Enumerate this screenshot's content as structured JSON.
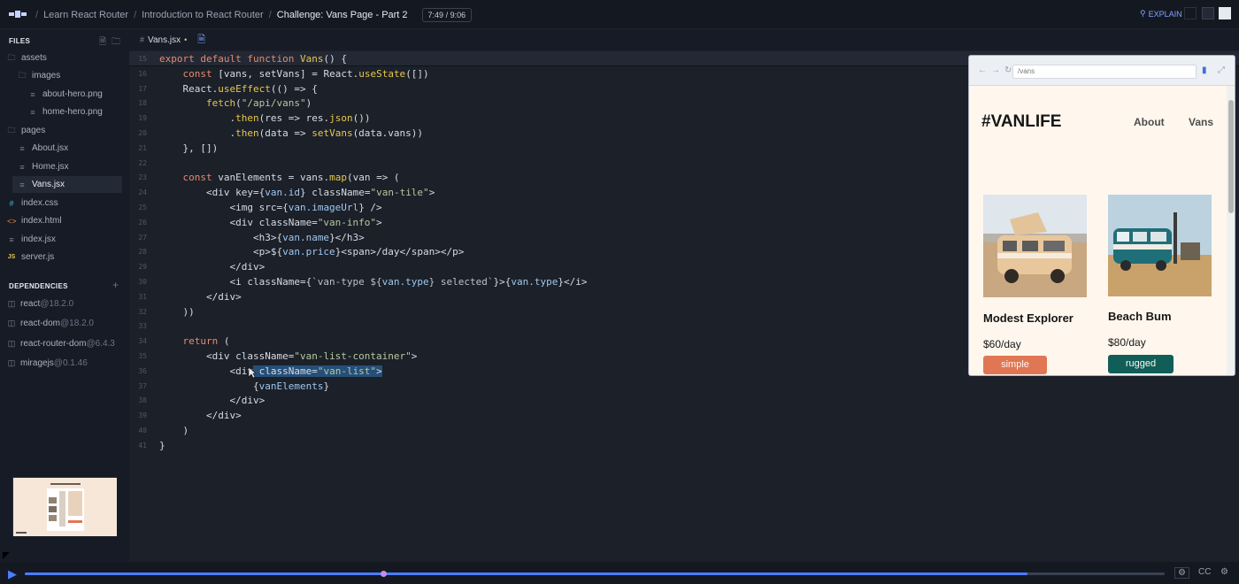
{
  "breadcrumb": {
    "items": [
      "Learn React Router",
      "Introduction to React Router",
      "Challenge: Vans Page - Part 2"
    ],
    "separator": "/",
    "time": "7:49 / 9:06"
  },
  "header": {
    "explain_label": "EXPLAIN"
  },
  "sidebar": {
    "files_heading": "FILES",
    "tree": [
      {
        "name": "assets",
        "type": "folder"
      },
      {
        "name": "images",
        "type": "folder"
      },
      {
        "name": "about-hero.png",
        "type": "file"
      },
      {
        "name": "home-hero.png",
        "type": "file"
      },
      {
        "name": "pages",
        "type": "folder"
      },
      {
        "name": "About.jsx",
        "type": "file"
      },
      {
        "name": "Home.jsx",
        "type": "file"
      },
      {
        "name": "Vans.jsx",
        "type": "file"
      },
      {
        "name": "index.css",
        "type": "css"
      },
      {
        "name": "index.html",
        "type": "html"
      },
      {
        "name": "index.jsx",
        "type": "file"
      },
      {
        "name": "server.js",
        "type": "js"
      }
    ],
    "dependencies_heading": "DEPENDENCIES",
    "dependencies": [
      {
        "name": "react",
        "version": "@18.2.0"
      },
      {
        "name": "react-dom",
        "version": "@18.2.0"
      },
      {
        "name": "react-router-dom",
        "version": "@6.4.3"
      },
      {
        "name": "miragejs",
        "version": "@0.1.46"
      }
    ]
  },
  "editor": {
    "tab_label": "Vans.jsx",
    "lines": [
      {
        "n": "15",
        "text": "export default function Vans() {"
      },
      {
        "n": "16",
        "text": "    const [vans, setVans] = React.useState([])"
      },
      {
        "n": "17",
        "text": "    React.useEffect(() => {"
      },
      {
        "n": "18",
        "text": "        fetch(\"/api/vans\")"
      },
      {
        "n": "19",
        "text": "            .then(res => res.json())"
      },
      {
        "n": "20",
        "text": "            .then(data => setVans(data.vans))"
      },
      {
        "n": "21",
        "text": "    }, [])"
      },
      {
        "n": "22",
        "text": ""
      },
      {
        "n": "23",
        "text": "    const vanElements = vans.map(van => ("
      },
      {
        "n": "24",
        "text": "        <div key={van.id} className=\"van-tile\">"
      },
      {
        "n": "25",
        "text": "            <img src={van.imageUrl} />"
      },
      {
        "n": "26",
        "text": "            <div className=\"van-info\">"
      },
      {
        "n": "27",
        "text": "                <h3>{van.name}</h3>"
      },
      {
        "n": "28",
        "text": "                <p>${van.price}<span>/day</span></p>"
      },
      {
        "n": "29",
        "text": "            </div>"
      },
      {
        "n": "30",
        "text": "            <i className={`van-type ${van.type} selected`}>{van.type}</i>"
      },
      {
        "n": "31",
        "text": "        </div>"
      },
      {
        "n": "32",
        "text": "    ))"
      },
      {
        "n": "33",
        "text": ""
      },
      {
        "n": "34",
        "text": "    return ("
      },
      {
        "n": "35",
        "text": "        <div className=\"van-list-container\">"
      },
      {
        "n": "36",
        "text": "            <div className=\"van-list\">"
      },
      {
        "n": "37",
        "text": "                {vanElements}"
      },
      {
        "n": "38",
        "text": "            </div>"
      },
      {
        "n": "39",
        "text": "        </div>"
      },
      {
        "n": "40",
        "text": "    )"
      },
      {
        "n": "41",
        "text": "}"
      }
    ]
  },
  "preview": {
    "url": "/vans",
    "brand": "#VANLIFE",
    "nav": [
      "About",
      "Vans"
    ],
    "vans": [
      {
        "name": "Modest Explorer",
        "price": "$60/day",
        "type": "simple",
        "color": "#e17654"
      },
      {
        "name": "Beach Bum",
        "price": "$80/day",
        "type": "rugged",
        "color": "#115e59"
      }
    ]
  },
  "player": {
    "cc_label": "CC",
    "progress_pct": 88,
    "marker_pct": 31.2
  },
  "colors": {
    "accent": "#4c7dff",
    "editor_bg": "#1c2029",
    "sidebar_bg": "#161b25"
  }
}
